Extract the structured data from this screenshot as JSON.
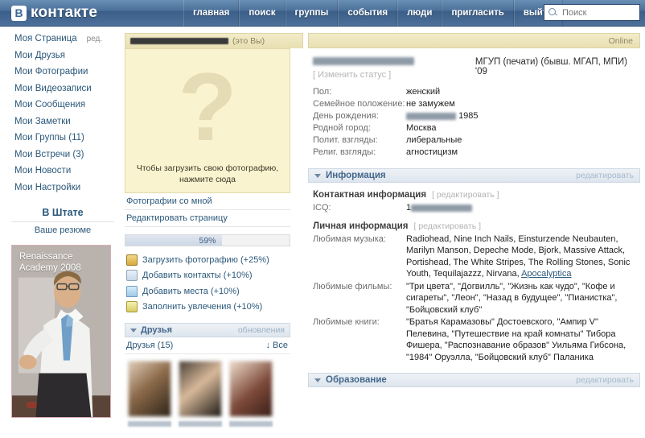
{
  "header": {
    "logo_badge": "В",
    "logo_text": "контакте",
    "nav": [
      {
        "label": "главная",
        "name": "nav-home"
      },
      {
        "label": "поиск",
        "name": "nav-search"
      },
      {
        "label": "группы",
        "name": "nav-groups"
      },
      {
        "label": "события",
        "name": "nav-events"
      },
      {
        "label": "люди",
        "name": "nav-people"
      },
      {
        "label": "пригласить",
        "name": "nav-invite"
      },
      {
        "label": "выйти",
        "name": "nav-logout"
      }
    ],
    "search": {
      "placeholder": "Поиск",
      "value": ""
    },
    "icons": {
      "search": "search-icon"
    },
    "colors": {
      "bar_top": "#6a8fb5",
      "bar_bottom": "#4c7099",
      "link": "#2b587a"
    }
  },
  "sidebar": {
    "items": [
      {
        "label": "Моя Страница",
        "sub": "ред."
      },
      {
        "label": "Мои Друзья",
        "sub": ""
      },
      {
        "label": "Мои Фотографии",
        "sub": ""
      },
      {
        "label": "Мои Видеозаписи",
        "sub": ""
      },
      {
        "label": "Мои Сообщения",
        "sub": ""
      },
      {
        "label": "Мои Заметки",
        "sub": ""
      },
      {
        "label": "Мои Группы (11)",
        "sub": ""
      },
      {
        "label": "Мои Встречи (3)",
        "sub": ""
      },
      {
        "label": "Мои Новости",
        "sub": ""
      },
      {
        "label": "Мои Настройки",
        "sub": ""
      }
    ],
    "staff": {
      "title": "В Штате",
      "link": "Ваше резюме"
    },
    "ad": {
      "text": "Renaissance\nAcademy 2008"
    }
  },
  "center": {
    "name_redacted": true,
    "you_label": "(это Вы)",
    "photo": {
      "placeholder_glyph": "?",
      "hint_line1": "Чтобы загрузить свою фотографию,",
      "hint_line2": "нажмите сюда"
    },
    "links": [
      {
        "label": "Фотографии со мной",
        "name": "photos-with-me-link"
      },
      {
        "label": "Редактировать страницу",
        "name": "edit-page-link"
      }
    ],
    "progress": {
      "percent_label": "59%",
      "percent": 59
    },
    "tasks": [
      {
        "label": "Загрузить фотографию (+25%)",
        "icon": "camera-icon",
        "icon_class": "cam"
      },
      {
        "label": "Добавить контакты (+10%)",
        "icon": "contact-card-icon",
        "icon_class": "card"
      },
      {
        "label": "Добавить места (+10%)",
        "icon": "home-icon",
        "icon_class": "home"
      },
      {
        "label": "Заполнить увлечения (+10%)",
        "icon": "pencil-icon",
        "icon_class": "pen"
      }
    ],
    "friends": {
      "title": "Друзья",
      "updates_label": "обновления",
      "count_label": "Друзья (15)",
      "all_label": "↓ Все"
    }
  },
  "right": {
    "online_label": "Online",
    "status_link": "[ Изменить статус ]",
    "university": "МГУП (печати) (бывш. МГАП, МПИ) '09",
    "facts": [
      {
        "key": "Пол:",
        "value": "женский"
      },
      {
        "key": "Семейное положение:",
        "value": "не замужем"
      },
      {
        "key": "День рождения:",
        "value": "1985",
        "redacted": true
      },
      {
        "key": "Родной город:",
        "value": "Москва"
      },
      {
        "key": "Полит. взгляды:",
        "value": "либеральные"
      },
      {
        "key": "Религ. взгляды:",
        "value": "агностицизм"
      }
    ],
    "info_section": {
      "title": "Информация",
      "edit": "редактировать"
    },
    "contact_info": {
      "title": "Контактная информация",
      "edit": "[ редактировать ]",
      "rows": [
        {
          "key": "ICQ:",
          "value": "1",
          "redacted": true
        }
      ]
    },
    "personal_info": {
      "title": "Личная информация",
      "edit": "[ редактировать ]",
      "rows": [
        {
          "key": "Любимая музыка:",
          "value": "Radiohead, Nine Inch Nails, Einsturzende Neubauten, Marilyn Manson, Depeche Mode, Bjork, Massive Attack, Portishead, The White Stripes, The Rolling Stones, Sonic Youth, Tequilajazzz, Nirvana, ",
          "link": "Apocalyptica"
        },
        {
          "key": "Любимые фильмы:",
          "value": "\"Три цвета\", \"Догвилль\", \"Жизнь как чудо\", \"Кофе и сигареты\", \"Леон\", \"Назад в будущее\", \"Пианистка\", \"Бойцовский клуб\"",
          "link": ""
        },
        {
          "key": "Любимые книги:",
          "value": "\"Братья Карамазовы\" Достоевского, \"Ампир V\" Пелевина, \"Путешествие на край комнаты\" Тибора Фишера, \"Распознавание образов\" Уильяма Гибсона, \"1984\" Оруэлла, \"Бойцовский клуб\" Паланика",
          "link": ""
        }
      ]
    },
    "education_section": {
      "title": "Образование",
      "edit": "редактировать"
    }
  }
}
